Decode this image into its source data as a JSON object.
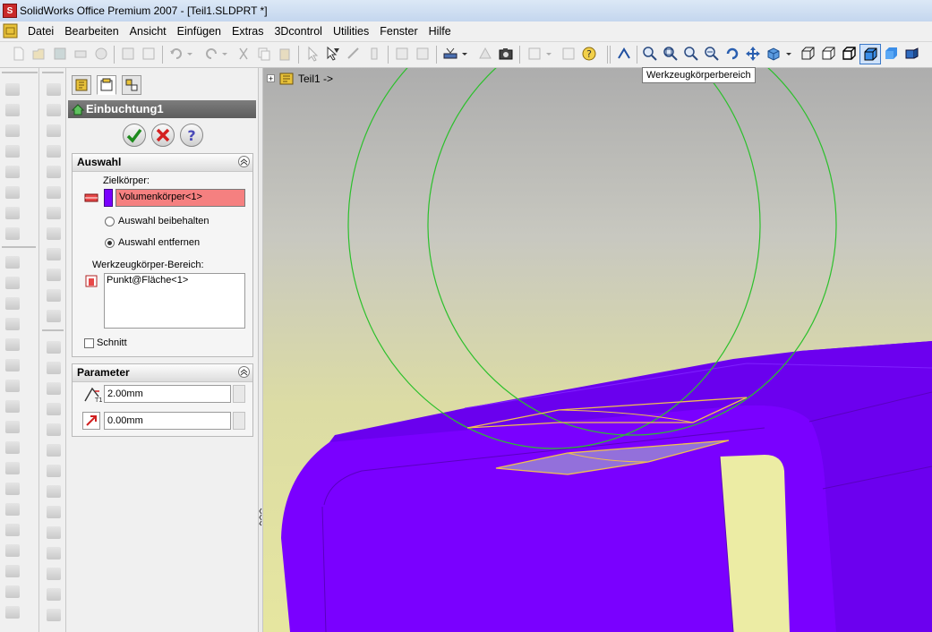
{
  "window": {
    "title": "SolidWorks Office Premium 2007 - [Teil1.SLDPRT *]"
  },
  "menu": [
    "Datei",
    "Bearbeiten",
    "Ansicht",
    "Einfügen",
    "Extras",
    "3Dcontrol",
    "Utilities",
    "Fenster",
    "Hilfe"
  ],
  "tooltip": "Werkzeugkörperbereich",
  "feature": {
    "name": "Einbuchtung1"
  },
  "auswahl": {
    "title": "Auswahl",
    "zielkoerper_label": "Zielkörper:",
    "zielkoerper_value": "Volumenkörper<1>",
    "radio_keep": "Auswahl beibehalten",
    "radio_remove": "Auswahl entfernen",
    "radio_selected": "Auswahl entfernen",
    "werkzeug_label": "Werkzeugkörper-Bereich:",
    "werkzeug_value": "Punkt@Fläche<1>",
    "schnitt_label": "Schnitt",
    "schnitt_checked": false
  },
  "parameter": {
    "title": "Parameter",
    "thickness": "2.00mm",
    "clearance": "0.00mm"
  },
  "tree": {
    "part_label": "Teil1 ->"
  },
  "colors": {
    "body": "#7a00ff",
    "selection_highlight": "#f58080",
    "tool_circle": "#2cc02c",
    "tool_edge": "#f0c050"
  }
}
